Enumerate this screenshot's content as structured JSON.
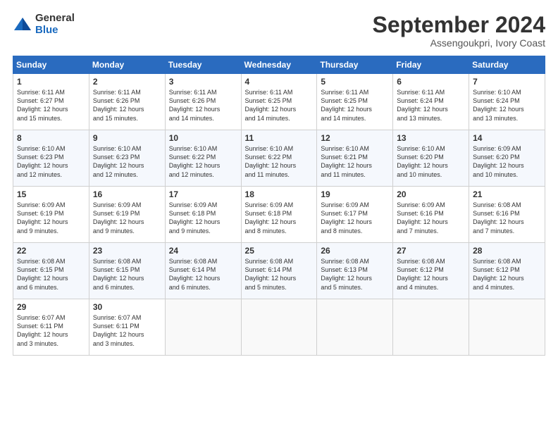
{
  "header": {
    "logo_general": "General",
    "logo_blue": "Blue",
    "month_title": "September 2024",
    "subtitle": "Assengoukpri, Ivory Coast"
  },
  "days_of_week": [
    "Sunday",
    "Monday",
    "Tuesday",
    "Wednesday",
    "Thursday",
    "Friday",
    "Saturday"
  ],
  "weeks": [
    [
      {
        "day": "1",
        "sunrise": "6:11 AM",
        "sunset": "6:27 PM",
        "daylight": "12 hours and 15 minutes."
      },
      {
        "day": "2",
        "sunrise": "6:11 AM",
        "sunset": "6:26 PM",
        "daylight": "12 hours and 15 minutes."
      },
      {
        "day": "3",
        "sunrise": "6:11 AM",
        "sunset": "6:26 PM",
        "daylight": "12 hours and 14 minutes."
      },
      {
        "day": "4",
        "sunrise": "6:11 AM",
        "sunset": "6:25 PM",
        "daylight": "12 hours and 14 minutes."
      },
      {
        "day": "5",
        "sunrise": "6:11 AM",
        "sunset": "6:25 PM",
        "daylight": "12 hours and 14 minutes."
      },
      {
        "day": "6",
        "sunrise": "6:11 AM",
        "sunset": "6:24 PM",
        "daylight": "12 hours and 13 minutes."
      },
      {
        "day": "7",
        "sunrise": "6:10 AM",
        "sunset": "6:24 PM",
        "daylight": "12 hours and 13 minutes."
      }
    ],
    [
      {
        "day": "8",
        "sunrise": "6:10 AM",
        "sunset": "6:23 PM",
        "daylight": "12 hours and 12 minutes."
      },
      {
        "day": "9",
        "sunrise": "6:10 AM",
        "sunset": "6:23 PM",
        "daylight": "12 hours and 12 minutes."
      },
      {
        "day": "10",
        "sunrise": "6:10 AM",
        "sunset": "6:22 PM",
        "daylight": "12 hours and 12 minutes."
      },
      {
        "day": "11",
        "sunrise": "6:10 AM",
        "sunset": "6:22 PM",
        "daylight": "12 hours and 11 minutes."
      },
      {
        "day": "12",
        "sunrise": "6:10 AM",
        "sunset": "6:21 PM",
        "daylight": "12 hours and 11 minutes."
      },
      {
        "day": "13",
        "sunrise": "6:10 AM",
        "sunset": "6:20 PM",
        "daylight": "12 hours and 10 minutes."
      },
      {
        "day": "14",
        "sunrise": "6:09 AM",
        "sunset": "6:20 PM",
        "daylight": "12 hours and 10 minutes."
      }
    ],
    [
      {
        "day": "15",
        "sunrise": "6:09 AM",
        "sunset": "6:19 PM",
        "daylight": "12 hours and 9 minutes."
      },
      {
        "day": "16",
        "sunrise": "6:09 AM",
        "sunset": "6:19 PM",
        "daylight": "12 hours and 9 minutes."
      },
      {
        "day": "17",
        "sunrise": "6:09 AM",
        "sunset": "6:18 PM",
        "daylight": "12 hours and 9 minutes."
      },
      {
        "day": "18",
        "sunrise": "6:09 AM",
        "sunset": "6:18 PM",
        "daylight": "12 hours and 8 minutes."
      },
      {
        "day": "19",
        "sunrise": "6:09 AM",
        "sunset": "6:17 PM",
        "daylight": "12 hours and 8 minutes."
      },
      {
        "day": "20",
        "sunrise": "6:09 AM",
        "sunset": "6:16 PM",
        "daylight": "12 hours and 7 minutes."
      },
      {
        "day": "21",
        "sunrise": "6:08 AM",
        "sunset": "6:16 PM",
        "daylight": "12 hours and 7 minutes."
      }
    ],
    [
      {
        "day": "22",
        "sunrise": "6:08 AM",
        "sunset": "6:15 PM",
        "daylight": "12 hours and 6 minutes."
      },
      {
        "day": "23",
        "sunrise": "6:08 AM",
        "sunset": "6:15 PM",
        "daylight": "12 hours and 6 minutes."
      },
      {
        "day": "24",
        "sunrise": "6:08 AM",
        "sunset": "6:14 PM",
        "daylight": "12 hours and 6 minutes."
      },
      {
        "day": "25",
        "sunrise": "6:08 AM",
        "sunset": "6:14 PM",
        "daylight": "12 hours and 5 minutes."
      },
      {
        "day": "26",
        "sunrise": "6:08 AM",
        "sunset": "6:13 PM",
        "daylight": "12 hours and 5 minutes."
      },
      {
        "day": "27",
        "sunrise": "6:08 AM",
        "sunset": "6:12 PM",
        "daylight": "12 hours and 4 minutes."
      },
      {
        "day": "28",
        "sunrise": "6:08 AM",
        "sunset": "6:12 PM",
        "daylight": "12 hours and 4 minutes."
      }
    ],
    [
      {
        "day": "29",
        "sunrise": "6:07 AM",
        "sunset": "6:11 PM",
        "daylight": "12 hours and 3 minutes."
      },
      {
        "day": "30",
        "sunrise": "6:07 AM",
        "sunset": "6:11 PM",
        "daylight": "12 hours and 3 minutes."
      },
      null,
      null,
      null,
      null,
      null
    ]
  ]
}
